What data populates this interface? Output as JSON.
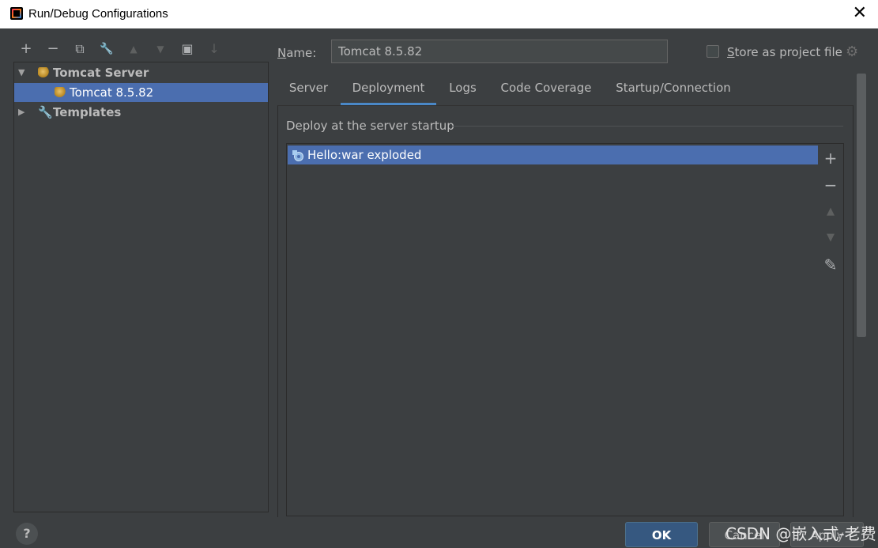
{
  "window": {
    "title": "Run/Debug Configurations"
  },
  "toolbar": {
    "add": "+",
    "remove": "−",
    "copy": "⧉",
    "edit": "🔧",
    "up": "▲",
    "down": "▼",
    "folder": "▣",
    "sort": "↓"
  },
  "tree": {
    "group": "Tomcat Server",
    "item": "Tomcat 8.5.82",
    "templates": "Templates"
  },
  "name": {
    "label_prefix": "N",
    "label_rest": "ame:",
    "value": "Tomcat 8.5.82"
  },
  "store": {
    "label_prefix": "S",
    "label_rest": "tore as project file"
  },
  "tabs": [
    "Server",
    "Deployment",
    "Logs",
    "Code Coverage",
    "Startup/Connection"
  ],
  "active_tab": "Deployment",
  "deploy": {
    "section_title": "Deploy at the server startup",
    "items": [
      "Hello:war exploded"
    ]
  },
  "side_buttons": {
    "add": "+",
    "remove": "−",
    "up": "▲",
    "down": "▼",
    "edit": "✎"
  },
  "footer": {
    "help": "?",
    "ok": "OK",
    "cancel": "Cancel",
    "apply": "Apply"
  },
  "watermark": "CSDN @嵌入式-老费"
}
